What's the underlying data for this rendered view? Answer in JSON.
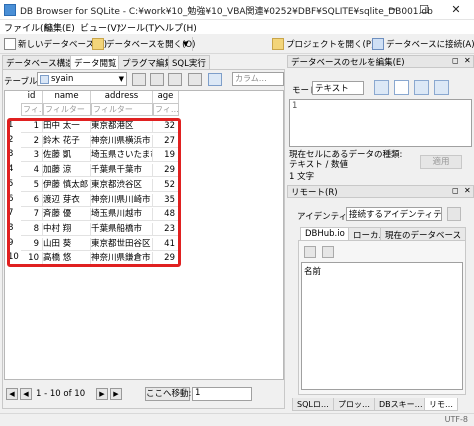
{
  "window": {
    "title": "DB Browser for SQLite - C:¥work¥10_勉強¥10_VBA関連¥0252¥DBF¥SQLITE¥sqlite_DB001.db",
    "min": "─",
    "max": "☐",
    "close": "✕"
  },
  "menu": [
    "ファイル(F)",
    "編集(E)",
    "ビュー(V)",
    "ツール(T)",
    "ヘルプ(H)"
  ],
  "toolbar": {
    "new_db": "新しいデータベース(N)",
    "open_db": "データベースを開く(O)",
    "open_project": "プロジェクトを開く(P)",
    "attach_db": "データベースに接続(A)"
  },
  "left_tabs": [
    "データベース構造",
    "データ閲覧",
    "プラグマ編集",
    "SQL実行"
  ],
  "browse": {
    "table_label": "テーブル(T):",
    "table_name": "syain",
    "filter_placeholder": "カラム…",
    "columns": [
      "id",
      "name",
      "address",
      "age"
    ],
    "filter_texts": [
      "フィ…",
      "フィルター",
      "フィルター",
      "フィ…"
    ],
    "rows": [
      {
        "n": "1",
        "id": "1",
        "name": "田中 太一",
        "address": "東京都港区",
        "age": "32"
      },
      {
        "n": "2",
        "id": "2",
        "name": "鈴木 花子",
        "address": "神奈川県横浜市",
        "age": "27"
      },
      {
        "n": "3",
        "id": "3",
        "name": "佐藤 凱",
        "address": "埼玉県さいたま市",
        "age": "19"
      },
      {
        "n": "4",
        "id": "4",
        "name": "加藤 涼",
        "address": "千葉県千葉市",
        "age": "29"
      },
      {
        "n": "5",
        "id": "5",
        "name": "伊藤 慎太郎",
        "address": "東京都渋谷区",
        "age": "52"
      },
      {
        "n": "6",
        "id": "6",
        "name": "渡辺 芽衣",
        "address": "神奈川県川崎市",
        "age": "35"
      },
      {
        "n": "7",
        "id": "7",
        "name": "斉藤 優",
        "address": "埼玉県川越市",
        "age": "48"
      },
      {
        "n": "8",
        "id": "8",
        "name": "中村 翔",
        "address": "千葉県船橋市",
        "age": "23"
      },
      {
        "n": "9",
        "id": "9",
        "name": "山田 葵",
        "address": "東京都世田谷区",
        "age": "41"
      },
      {
        "n": "10",
        "id": "10",
        "name": "高橋 悠",
        "address": "神奈川県鎌倉市",
        "age": "29"
      }
    ],
    "nav_first": "◀",
    "nav_prev": "◀",
    "nav_status": "1 - 10 of 10",
    "nav_next": "▶",
    "nav_last": "▶",
    "goto_label": "ここへ移動:",
    "goto_value": "1"
  },
  "edit_cell": {
    "title": "データベースのセルを編集(E)",
    "mode_label": "モード:",
    "mode_value": "テキスト",
    "editor_line": "1",
    "type_text": "現在セルにあるデータの種類: テキスト / 数値",
    "size_text": "1 文字",
    "apply": "適用"
  },
  "remote": {
    "title": "リモート(R)",
    "identity_label": "アイデンティティー",
    "identity_value": "接続するアイデンティティー",
    "tabs": [
      "DBHub.io",
      "ローカル",
      "現在のデータベース"
    ],
    "name_header": "名前"
  },
  "bottom_tabs": [
    "SQLロ…",
    "プロッ…",
    "DBスキー…",
    "リモ…"
  ],
  "status": {
    "encoding": "UTF-8"
  },
  "colors": {
    "highlight": "#e02020"
  }
}
